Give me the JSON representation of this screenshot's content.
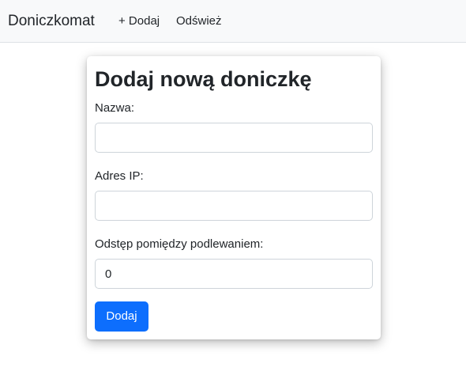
{
  "navbar": {
    "brand": "Doniczkomat",
    "links": [
      {
        "label": "+ Dodaj"
      },
      {
        "label": "Odśwież"
      }
    ]
  },
  "form": {
    "title": "Dodaj nową doniczkę",
    "fields": {
      "name": {
        "label": "Nazwa:",
        "value": ""
      },
      "ip": {
        "label": "Adres IP:",
        "value": ""
      },
      "interval": {
        "label": "Odstęp pomiędzy podlewaniem:",
        "value": "0"
      }
    },
    "submit_label": "Dodaj"
  },
  "colors": {
    "primary": "#0d6efd",
    "navbar_bg": "#f8f9fa"
  }
}
